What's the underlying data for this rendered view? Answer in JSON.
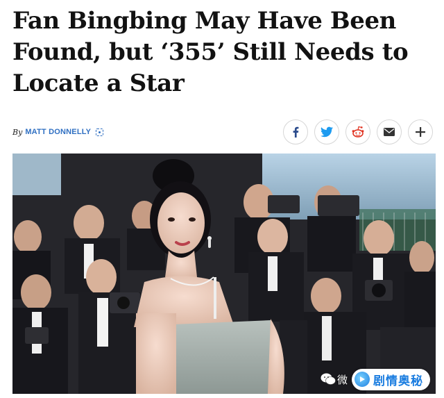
{
  "article": {
    "headline_lines": [
      "Fan Bingbing May Have Been",
      "Found, but ‘355’ Still Needs to",
      "Locate a Star"
    ],
    "byline_prefix": "By",
    "author": "MATT DONNELLY"
  },
  "share_buttons": [
    {
      "icon": "facebook-icon",
      "color": "#2b4b8c"
    },
    {
      "icon": "twitter-icon",
      "color": "#1d9bf0"
    },
    {
      "icon": "reddit-icon",
      "color": "#e0301e"
    },
    {
      "icon": "email-icon",
      "color": "#333333"
    },
    {
      "icon": "plus-icon",
      "color": "#333333"
    }
  ],
  "colors": {
    "author_link": "#2f6fc2",
    "watermark_text": "#1b7de0"
  },
  "watermark": {
    "prefix": "微",
    "brand": "剧情奥秘"
  }
}
